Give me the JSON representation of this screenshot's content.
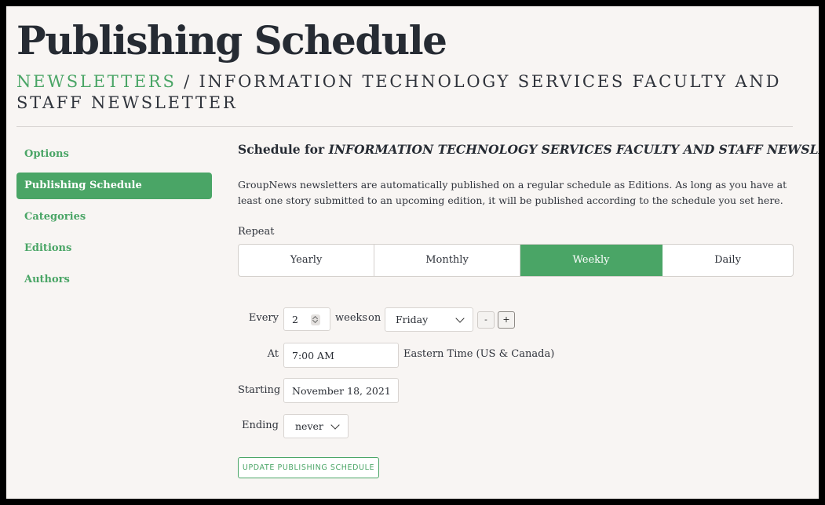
{
  "page": {
    "title": "Publishing Schedule",
    "breadcrumb": {
      "link": "NEWSLETTERS",
      "separator": " / ",
      "current": "INFORMATION TECHNOLOGY SERVICES FACULTY AND STAFF NEWSLETTER"
    }
  },
  "sidebar": {
    "items": [
      {
        "label": "Options",
        "active": false
      },
      {
        "label": "Publishing Schedule",
        "active": true
      },
      {
        "label": "Categories",
        "active": false
      },
      {
        "label": "Editions",
        "active": false
      },
      {
        "label": "Authors",
        "active": false
      }
    ]
  },
  "main": {
    "heading_prefix": "Schedule for ",
    "heading_name": "INFORMATION TECHNOLOGY SERVICES FACULTY AND STAFF NEWSLETTER",
    "intro": "GroupNews newsletters are automatically published on a regular schedule as Editions. As long as you have at least one story submitted to an upcoming edition, it will be published according to the schedule you set here.",
    "repeat_label": "Repeat",
    "repeat_options": [
      "Yearly",
      "Monthly",
      "Weekly",
      "Daily"
    ],
    "repeat_selected": "Weekly"
  },
  "form": {
    "every_label": "Every",
    "every_value": "2",
    "unit_text": "weeks",
    "on_text": "on",
    "day_value": "Friday",
    "minus_label": "-",
    "plus_label": "+",
    "at_label": "At",
    "time_value": "7:00 AM",
    "timezone": "Eastern Time (US & Canada)",
    "starting_label": "Starting",
    "start_value": "November 18, 2021",
    "ending_label": "Ending",
    "ending_value": "never"
  },
  "actions": {
    "update_label": "UPDATE PUBLISHING SCHEDULE"
  },
  "colors": {
    "accent": "#4aa566",
    "background": "#f8f5f3",
    "text": "#262b33"
  }
}
